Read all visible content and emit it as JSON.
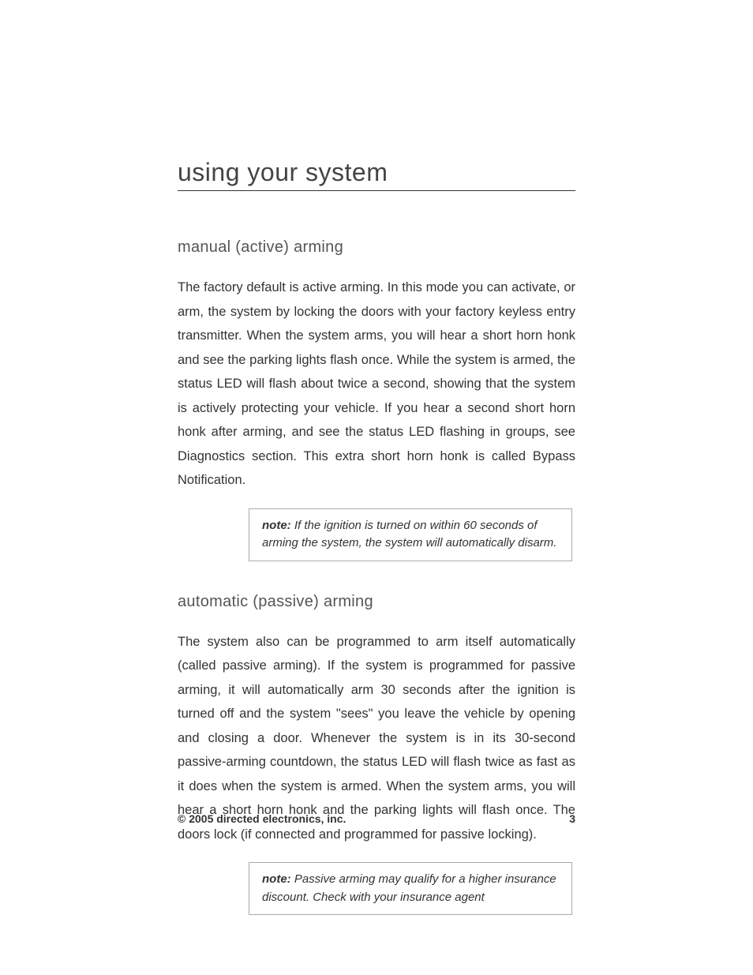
{
  "heading": "using your system",
  "section1": {
    "title": "manual (active) arming",
    "body": "The factory default is active arming. In this mode you can activate, or arm, the system by locking the doors with your factory keyless entry transmitter. When the system arms, you will hear a short horn honk and see the parking lights flash once. While the system is armed, the status LED will flash about twice a second, showing that the system is actively protecting your vehicle. If you hear a second short horn honk after arming, and see the status LED flashing in groups, see Diagnostics section. This extra short horn honk is called Bypass Notification.",
    "note_label": "note:",
    "note_text": " If the ignition is turned on within 60 seconds of arming the system, the system will automatically disarm."
  },
  "section2": {
    "title": "automatic (passive) arming",
    "body": "The system also can be programmed to arm itself automatically (called passive arming). If the system is programmed for passive arming, it will automatically arm 30 seconds after the ignition is turned off and the system \"sees\" you leave the vehicle by opening and closing a door. Whenever the system is in its 30-second passive-arming countdown, the status LED will flash twice as fast as it does when the system is armed. When the system arms, you will hear a short horn honk and the parking lights will flash once. The doors lock (if connected and programmed for passive locking).",
    "note_label": "note:",
    "note_text": " Passive arming may qualify for a higher insurance discount. Check with your insurance agent"
  },
  "footer": {
    "copyright": "© 2005 directed electronics, inc.",
    "page_number": "3"
  }
}
